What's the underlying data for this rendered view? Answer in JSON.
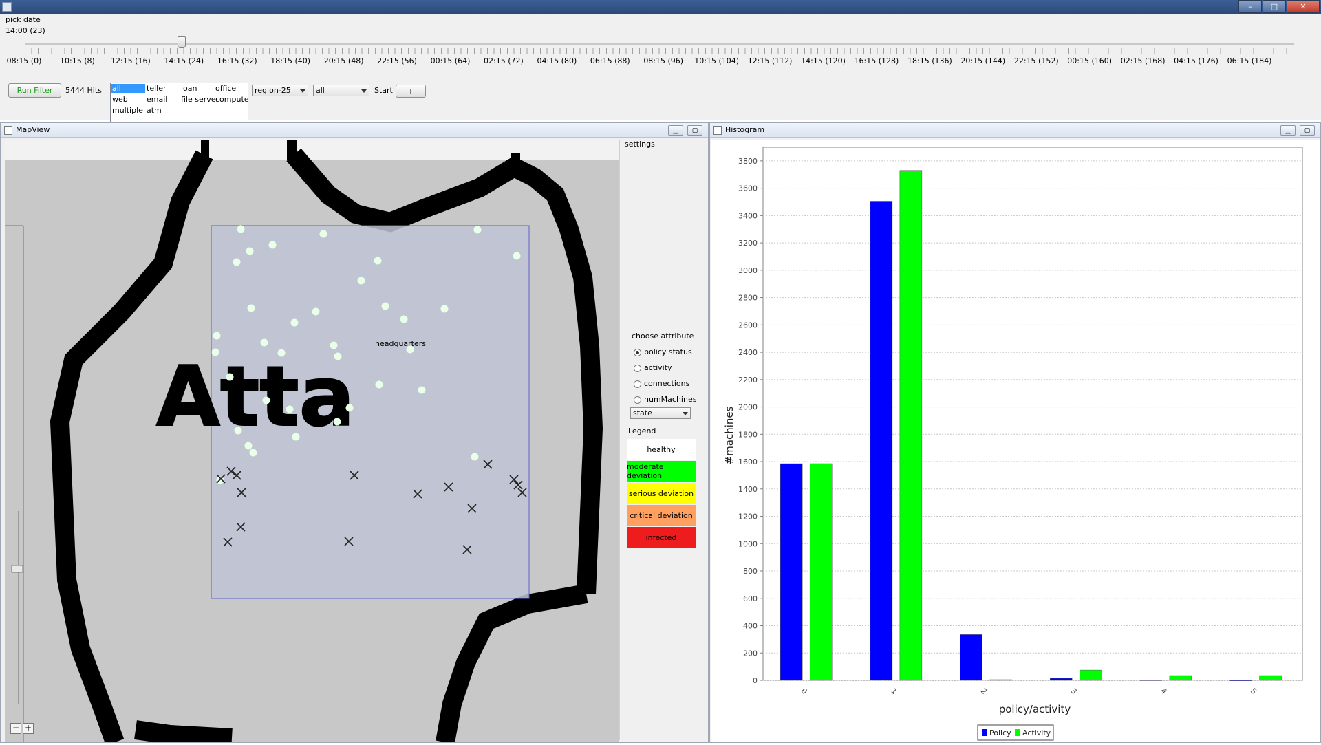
{
  "window": {
    "buttons": [
      "–",
      "□",
      "✕"
    ]
  },
  "top": {
    "pick_date_label": "pick date",
    "current_time": "14:00 (23)",
    "slider_fraction": 0.123,
    "time_labels": [
      "08:15 (0)",
      "10:15 (8)",
      "12:15 (16)",
      "14:15 (24)",
      "16:15 (32)",
      "18:15 (40)",
      "20:15 (48)",
      "22:15 (56)",
      "00:15 (64)",
      "02:15 (72)",
      "04:15 (80)",
      "06:15 (88)",
      "08:15 (96)",
      "10:15 (104)",
      "12:15 (112)",
      "14:15 (120)",
      "16:15 (128)",
      "18:15 (136)",
      "20:15 (144)",
      "22:15 (152)",
      "00:15 (160)",
      "02:15 (168)",
      "04:15 (176)",
      "06:15 (184)"
    ],
    "run_filter_label": "Run Filter",
    "hits_label": "5444 Hits",
    "filter_items": [
      {
        "label": "all",
        "selected": true
      },
      {
        "label": "teller",
        "selected": false
      },
      {
        "label": "loan",
        "selected": false
      },
      {
        "label": "office",
        "selected": false
      },
      {
        "label": "web",
        "selected": false
      },
      {
        "label": "email",
        "selected": false
      },
      {
        "label": "file server",
        "selected": false
      },
      {
        "label": "compute",
        "selected": false
      },
      {
        "label": "multiple",
        "selected": false
      },
      {
        "label": "atm",
        "selected": false
      }
    ],
    "region_select": "region-25",
    "scope_select": "all",
    "start_label": "Start",
    "plus_label": "+"
  },
  "mapview": {
    "title": "MapView",
    "settings_label": "settings",
    "map_text": "Atta",
    "hq_label": "headquarters",
    "choose_attribute_label": "choose attribute",
    "attributes": [
      {
        "label": "policy status",
        "checked": true
      },
      {
        "label": "activity",
        "checked": false
      },
      {
        "label": "connections",
        "checked": false
      },
      {
        "label": "numMachines",
        "checked": false
      }
    ],
    "group_select": "state",
    "legend_title": "Legend",
    "legend": [
      {
        "label": "healthy",
        "color": "#ffffff"
      },
      {
        "label": "moderate deviation",
        "color": "#00ff00"
      },
      {
        "label": "serious deviation",
        "color": "#ffff00"
      },
      {
        "label": "critical deviation",
        "color": "#ffa060"
      },
      {
        "label": "infected",
        "color": "#ee1c1c"
      }
    ],
    "zoom_out": "−",
    "zoom_in": "+",
    "zoom_fraction": 0.3,
    "dot_color": "#e8ffe8"
  },
  "histogram": {
    "title": "Histogram"
  },
  "chart_data": {
    "type": "bar",
    "title": "",
    "xlabel": "policy/activity",
    "ylabel": "#machines",
    "categories": [
      "0",
      "1",
      "2",
      "3",
      "4",
      "5"
    ],
    "ylim": [
      0,
      3900
    ],
    "yticks": [
      0,
      200,
      400,
      600,
      800,
      1000,
      1200,
      1400,
      1600,
      1800,
      2000,
      2200,
      2400,
      2600,
      2800,
      3000,
      3200,
      3400,
      3600,
      3800
    ],
    "grid": true,
    "legend_position": "bottom-center",
    "series": [
      {
        "name": "Policy",
        "color": "#0000ff",
        "values": [
          1585,
          3505,
          335,
          15,
          2,
          1
        ]
      },
      {
        "name": "Activity",
        "color": "#00ff00",
        "values": [
          1585,
          3730,
          5,
          75,
          35,
          35
        ]
      }
    ]
  }
}
